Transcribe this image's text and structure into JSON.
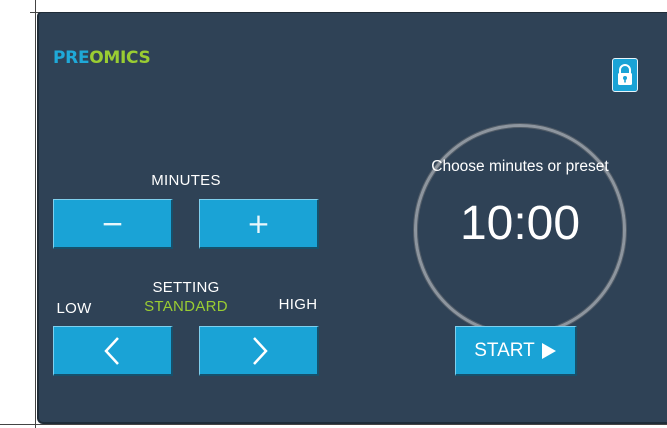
{
  "brand": {
    "part1": "PRE",
    "part2": "OMICS"
  },
  "lock": {
    "icon": "lock-icon"
  },
  "minutes": {
    "label": "MINUTES",
    "decrease_glyph": "−",
    "increase_glyph": "+"
  },
  "setting": {
    "label": "SETTING",
    "current": "STANDARD",
    "low_label": "LOW",
    "high_label": "HIGH",
    "prev_icon": "chevron-left-icon",
    "next_icon": "chevron-right-icon"
  },
  "timer": {
    "prompt": "Choose minutes or preset",
    "value": "10:00"
  },
  "start": {
    "label": "START",
    "icon": "play-icon"
  },
  "colors": {
    "panel": "#2f4256",
    "button": "#1aa3d6",
    "accent_green": "#9acd32",
    "brand_blue": "#1fa9d8"
  }
}
